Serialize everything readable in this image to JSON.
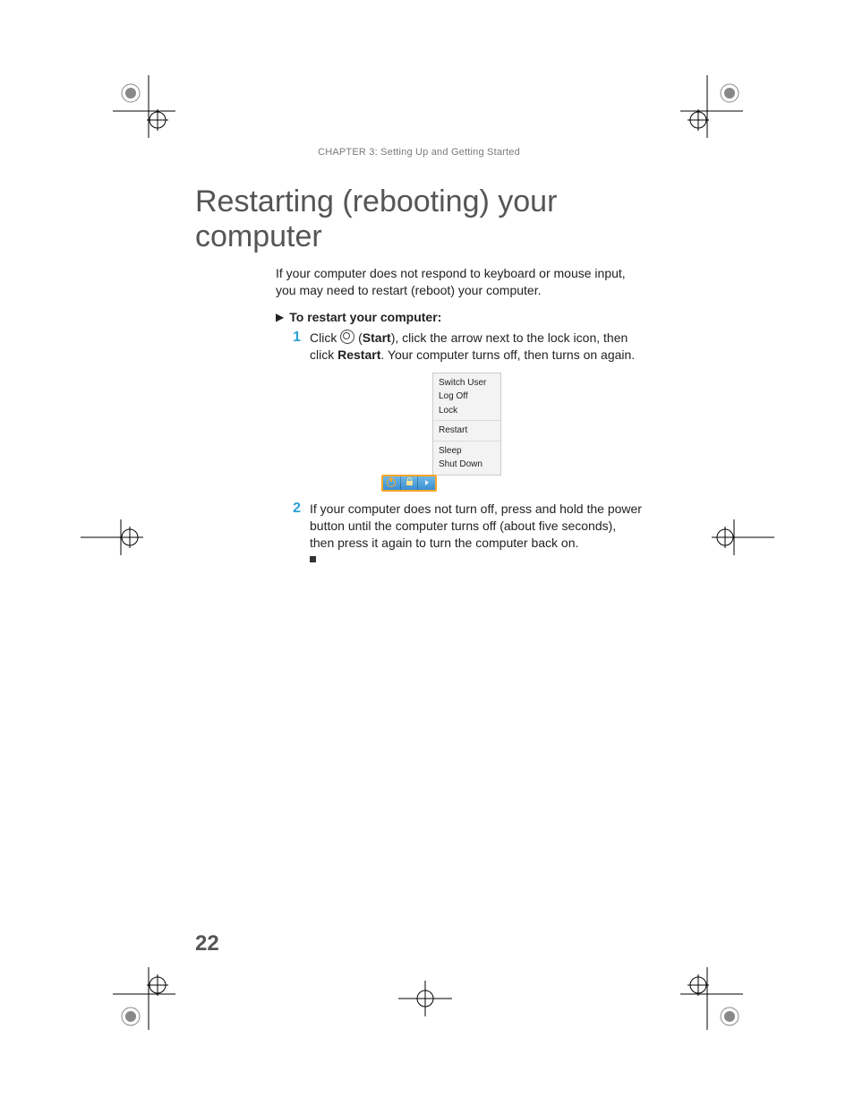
{
  "header": {
    "chapter_line": "CHAPTER 3: Setting Up and Getting Started"
  },
  "title": "Restarting (rebooting) your computer",
  "intro": "If your computer does not respond to keyboard or mouse input, you may need to restart (reboot) your computer.",
  "subhead": "To restart your computer:",
  "steps": {
    "s1": {
      "num": "1",
      "pre": "Click ",
      "label_start": "Start",
      "mid": "), click the arrow next to the lock icon, then click ",
      "label_restart": "Restart",
      "post": ". Your computer turns off, then turns on again."
    },
    "s2": {
      "num": "2",
      "text": "If your computer does not turn off, press and hold the power button until the computer turns off (about five seconds), then press it again to turn the computer back on."
    }
  },
  "menu": {
    "switch_user": "Switch User",
    "log_off": "Log Off",
    "lock": "Lock",
    "restart": "Restart",
    "sleep": "Sleep",
    "shut_down": "Shut Down"
  },
  "page_number": "22"
}
